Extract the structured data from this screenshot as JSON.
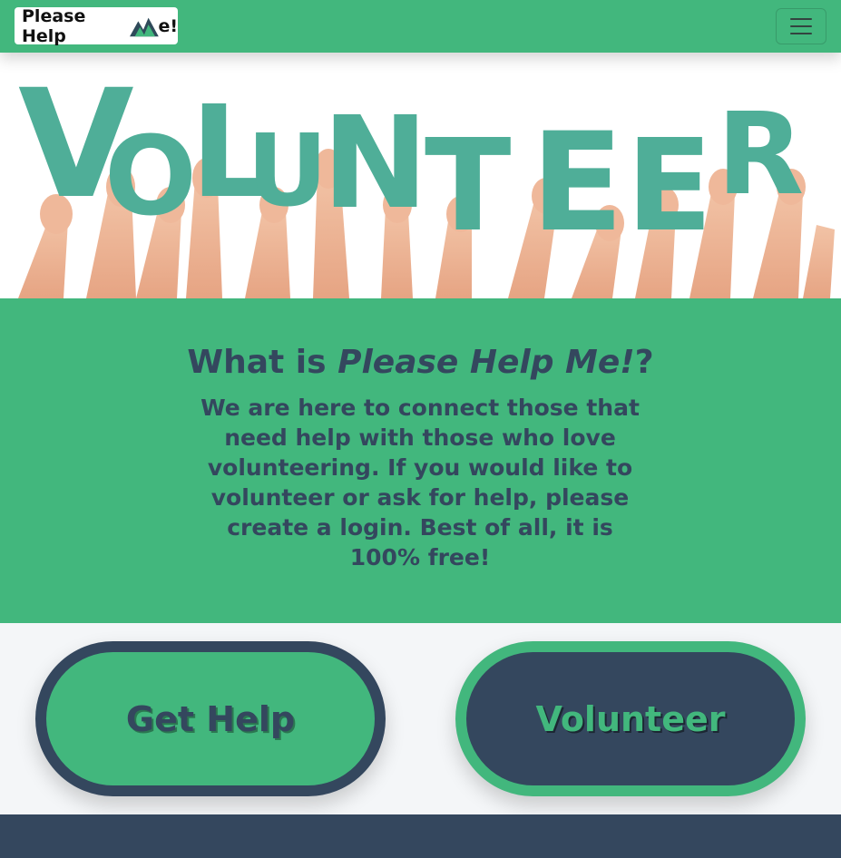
{
  "navbar": {
    "brand_prefix": "Please Help ",
    "brand_suffix": "e!",
    "menu_button": "toggle navigation menu",
    "colors": {
      "background": "#42b77d",
      "logo_dark": "#2f4a5a",
      "logo_green": "#42b77d"
    }
  },
  "hero": {
    "image_text": "VOLUNTEER",
    "image_description": "hands holding up teal cut-out letters",
    "letter_color": "#4fae98"
  },
  "about": {
    "heading_prefix": "What is ",
    "heading_emphasis": "Please Help Me!",
    "heading_suffix": "?",
    "body": "We are here to connect those that need help with those who love volunteering. If you would like to volunteer or ask for help, please create a login. Best of all, it is 100% free!"
  },
  "actions": {
    "get_help_label": "Get Help",
    "volunteer_label": "Volunteer"
  },
  "colors": {
    "green": "#42b77d",
    "navy": "#34475e",
    "light": "#f4f6f8"
  }
}
